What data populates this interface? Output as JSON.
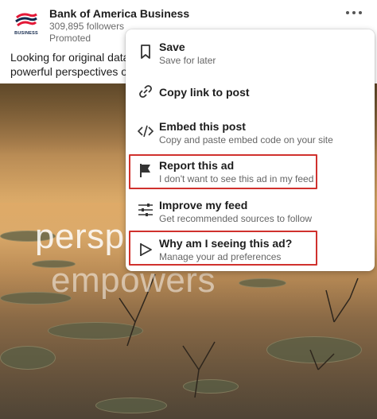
{
  "header": {
    "logo_text": "BUSINESS",
    "company": "Bank of America Business",
    "followers": "309,895 followers",
    "promoted": "Promoted",
    "more_icon": "ellipsis-icon"
  },
  "post_text": {
    "line1": "Looking for original data-d",
    "line2": "powerful perspectives on"
  },
  "image": {
    "word1": "persp",
    "word2": "empowers"
  },
  "menu": {
    "items": [
      {
        "icon": "bookmark-icon",
        "title": "Save",
        "subtitle": "Save for later"
      },
      {
        "icon": "link-icon",
        "title": "Copy link to post",
        "subtitle": ""
      },
      {
        "icon": "code-icon",
        "title": "Embed this post",
        "subtitle": "Copy and paste embed code on your site"
      },
      {
        "icon": "flag-icon",
        "title": "Report this ad",
        "subtitle": "I don't want to see this ad in my feed"
      },
      {
        "icon": "sliders-icon",
        "title": "Improve my feed",
        "subtitle": "Get recommended sources to follow"
      },
      {
        "icon": "play-outline-icon",
        "title": "Why am I seeing this ad?",
        "subtitle": "Manage your ad preferences"
      }
    ]
  },
  "colors": {
    "highlight_border": "#d0312d",
    "brand_navy": "#12284c",
    "brand_red": "#e31837"
  }
}
